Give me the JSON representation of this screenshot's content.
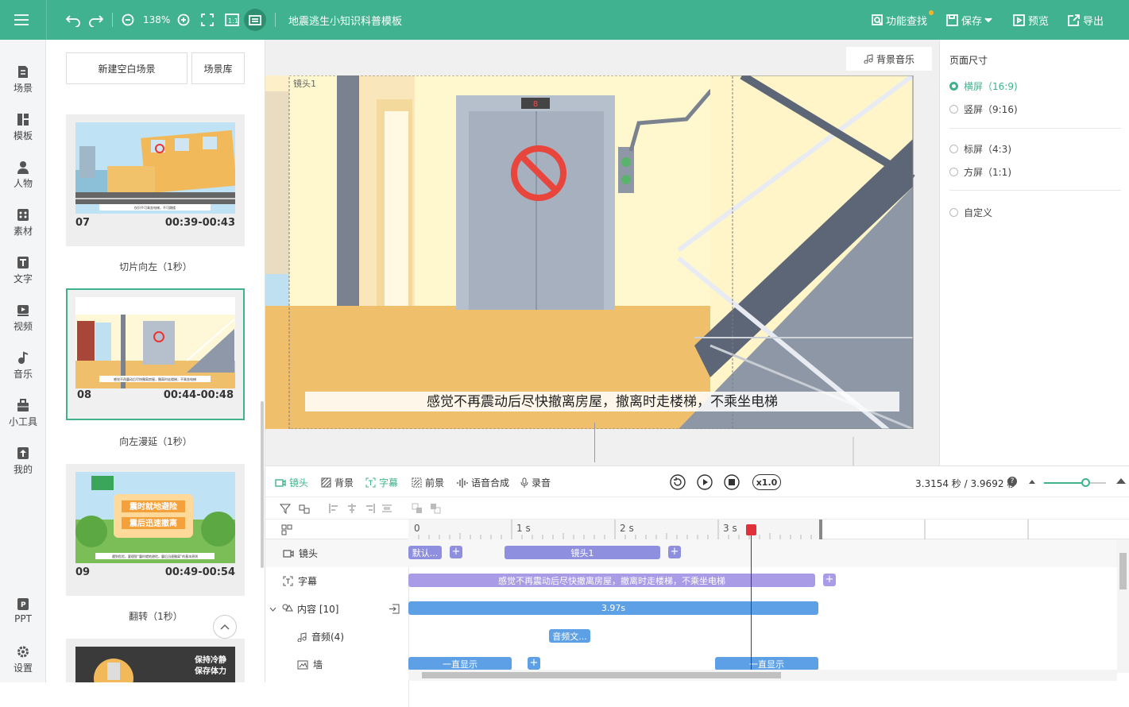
{
  "toolbar": {
    "zoom": "138%",
    "doc_title": "地震逃生小知识科普模板",
    "find_label": "功能查找",
    "save_label": "保存",
    "preview_label": "预览",
    "export_label": "导出",
    "accent": "#41b28f"
  },
  "sidenav": {
    "items": [
      {
        "label": "场景",
        "icon": "scene-icon"
      },
      {
        "label": "模板",
        "icon": "template-icon"
      },
      {
        "label": "人物",
        "icon": "person-icon"
      },
      {
        "label": "素材",
        "icon": "material-icon"
      },
      {
        "label": "文字",
        "icon": "text-icon"
      },
      {
        "label": "视频",
        "icon": "video-icon"
      },
      {
        "label": "音乐",
        "icon": "music-icon"
      },
      {
        "label": "小工具",
        "icon": "toolbox-icon"
      },
      {
        "label": "我的",
        "icon": "upload-icon"
      },
      {
        "label": "PPT",
        "icon": "ppt-icon"
      },
      {
        "label": "设置",
        "icon": "gear-icon"
      }
    ]
  },
  "scenes": {
    "new_blank": "新建空白场景",
    "library": "场景库",
    "cards": [
      {
        "num": "07",
        "time": "00:39-00:43",
        "caption": "仅识不可乘坐电梯，不可跳楼",
        "transition": "切片向左（1秒）"
      },
      {
        "num": "08",
        "time": "00:44-00:48",
        "caption": "感觉不再震动后尽快撤离房屋，撤离时走楼梯，不乘坐电梯",
        "transition": "向左漫延（1秒）"
      },
      {
        "num": "09",
        "time": "00:49-00:54",
        "caption": "遇到危险，要理智“震时就地避险，震后迅速撤离”的基本原则",
        "transition": "翻转（1秒）",
        "sign1": "震时就地避险",
        "sign2": "震后迅速撤离"
      },
      {
        "sign1": "保持冷静",
        "sign2": "保存体力"
      }
    ]
  },
  "canvas": {
    "bg_music": "背景音乐",
    "shot_label": "镜头1",
    "elevator_floor": "8",
    "subtitle": "感觉不再震动后尽快撤离房屋，撤离时走楼梯，不乘坐电梯"
  },
  "page_size": {
    "title": "页面尺寸",
    "options": [
      {
        "label": "横屏（16:9)",
        "selected": true
      },
      {
        "label": "竖屏（9:16)",
        "selected": false
      },
      {
        "label": "标屏（4:3)",
        "selected": false
      },
      {
        "label": "方屏（1:1)",
        "selected": false
      },
      {
        "label": "自定义",
        "selected": false
      }
    ]
  },
  "timeline": {
    "tools": [
      "镜头",
      "背景",
      "字幕",
      "前景",
      "语音合成",
      "录音"
    ],
    "speed": "x1.0",
    "time_readout": "3.3154 秒 / 3.9692 秒",
    "ruler": [
      "0",
      "1 s",
      "2 s",
      "3 s"
    ],
    "rows": {
      "shot": "镜头",
      "subtitle": "字幕",
      "content": "内容 [10]",
      "audio": "音频(4)",
      "wall": "墙"
    },
    "clips": {
      "shot_default": "默认...",
      "shot1": "镜头1",
      "subtitle": "感觉不再震动后尽快撤离房屋，撤离时走楼梯，不乘坐电梯",
      "content": "3.97s",
      "audio": "音频文...",
      "wall1": "一直显示",
      "wall2": "一直显示"
    },
    "playhead_seconds": 3.3154,
    "total_seconds": 3.9692
  }
}
